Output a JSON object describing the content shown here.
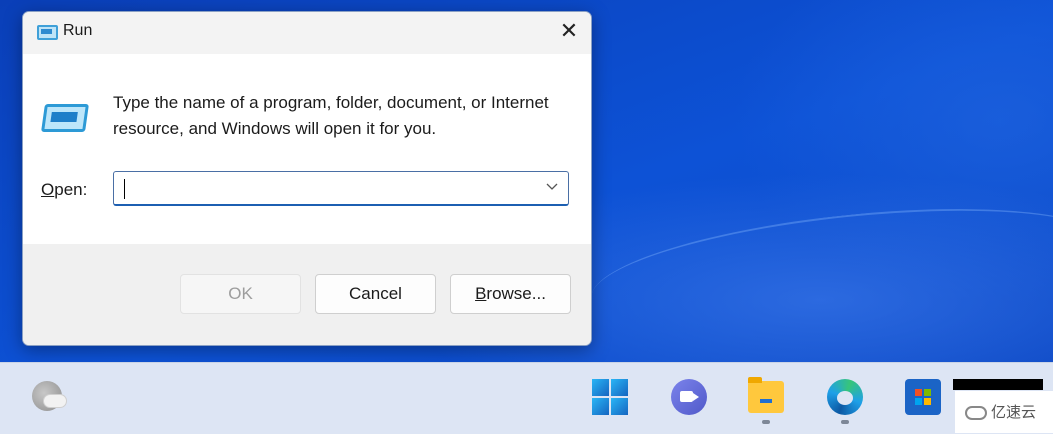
{
  "dialog": {
    "title": "Run",
    "close_glyph": "✕",
    "description": "Type the name of a program, folder, document, or Internet resource, and Windows will open it for you.",
    "open_label_prefix": "",
    "open_label_accel": "O",
    "open_label_rest": "pen:",
    "open_value": "",
    "buttons": {
      "ok": "OK",
      "cancel": "Cancel",
      "browse_accel": "B",
      "browse_rest": "rowse..."
    }
  },
  "taskbar": {
    "icons": [
      "weather-icon",
      "windows-start-icon",
      "teams-chat-icon",
      "file-explorer-icon",
      "edge-browser-icon",
      "microsoft-store-icon"
    ],
    "watermark_text": "亿速云"
  },
  "colors": {
    "desktop_blue": "#0b47c4",
    "accent": "#1c5fb2",
    "taskbar": "#dde5f4"
  }
}
